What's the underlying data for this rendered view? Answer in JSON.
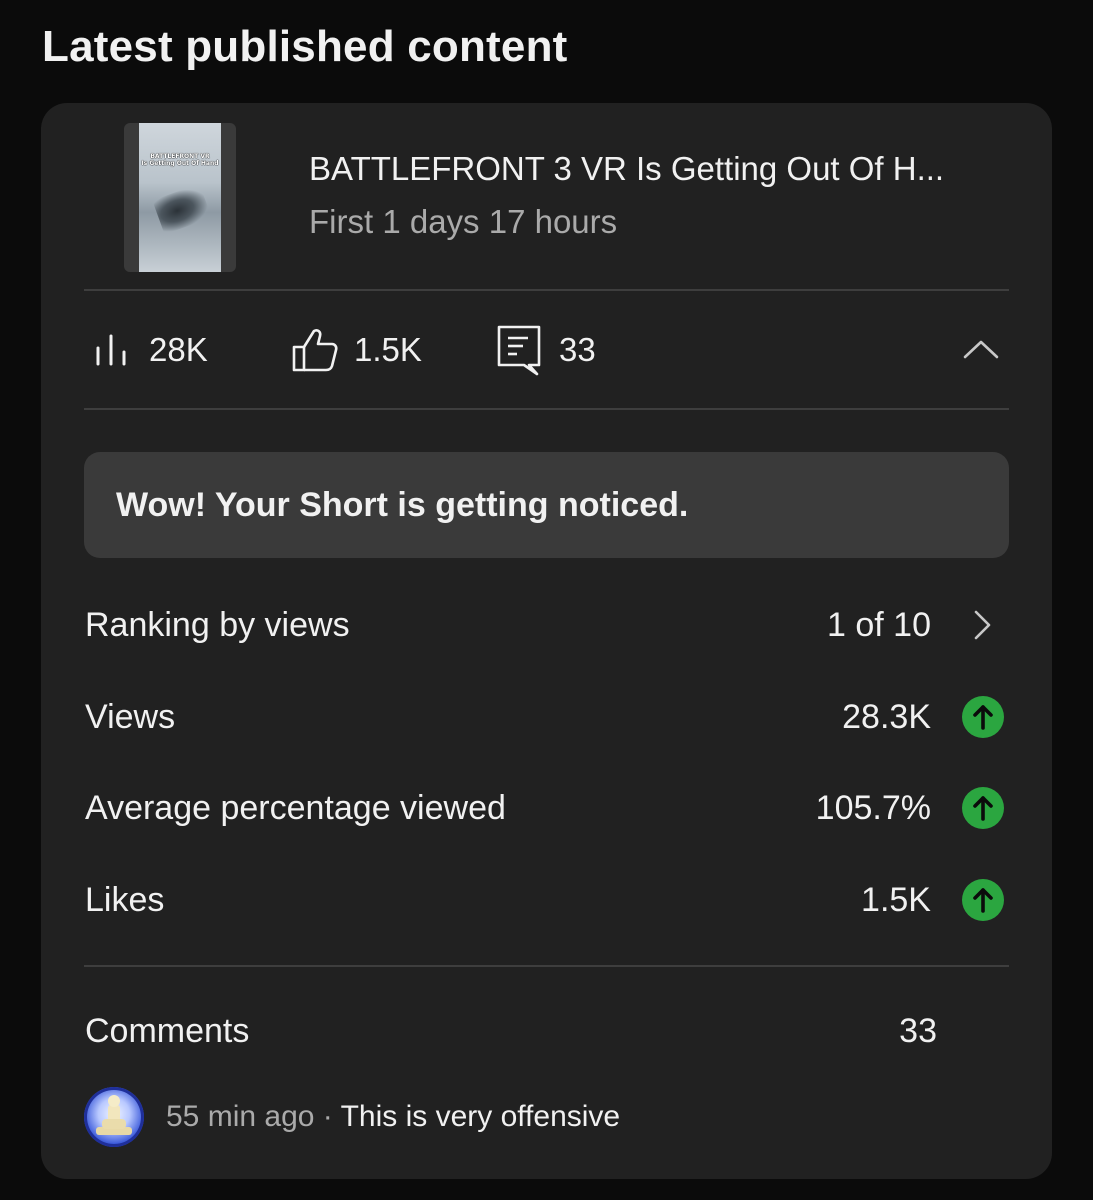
{
  "section_title": "Latest published content",
  "video": {
    "thumbnail_caption_line1": "BATTLEFRONT VR",
    "thumbnail_caption_line2": "Is Getting Out Of Hand",
    "title": "BATTLEFRONT 3 VR Is Getting Out Of H...",
    "subtitle": "First 1 days 17 hours"
  },
  "stats": {
    "views": "28K",
    "likes": "1.5K",
    "comments": "33",
    "views_icon": "bar-chart-icon",
    "likes_icon": "thumbs-up-icon",
    "comments_icon": "comment-icon",
    "collapse_icon": "chevron-up-icon"
  },
  "notice": {
    "text": "Wow! Your Short is getting noticed."
  },
  "metrics": [
    {
      "label": "Ranking by views",
      "value": "1 of 10",
      "indicator": "chevron-right-icon"
    },
    {
      "label": "Views",
      "value": "28.3K",
      "indicator": "arrow-up-circle-icon"
    },
    {
      "label": "Average percentage viewed",
      "value": "105.7%",
      "indicator": "arrow-up-circle-icon"
    },
    {
      "label": "Likes",
      "value": "1.5K",
      "indicator": "arrow-up-circle-icon"
    }
  ],
  "comments": {
    "label": "Comments",
    "count": "33",
    "latest": {
      "time": "55 min ago",
      "separator": " · ",
      "text": "This is very offensive"
    }
  },
  "colors": {
    "background": "#0b0b0b",
    "card": "#212121",
    "notice": "#3a3a3a",
    "up_indicator": "#2ba640",
    "secondary_text": "#aaaaaa"
  }
}
